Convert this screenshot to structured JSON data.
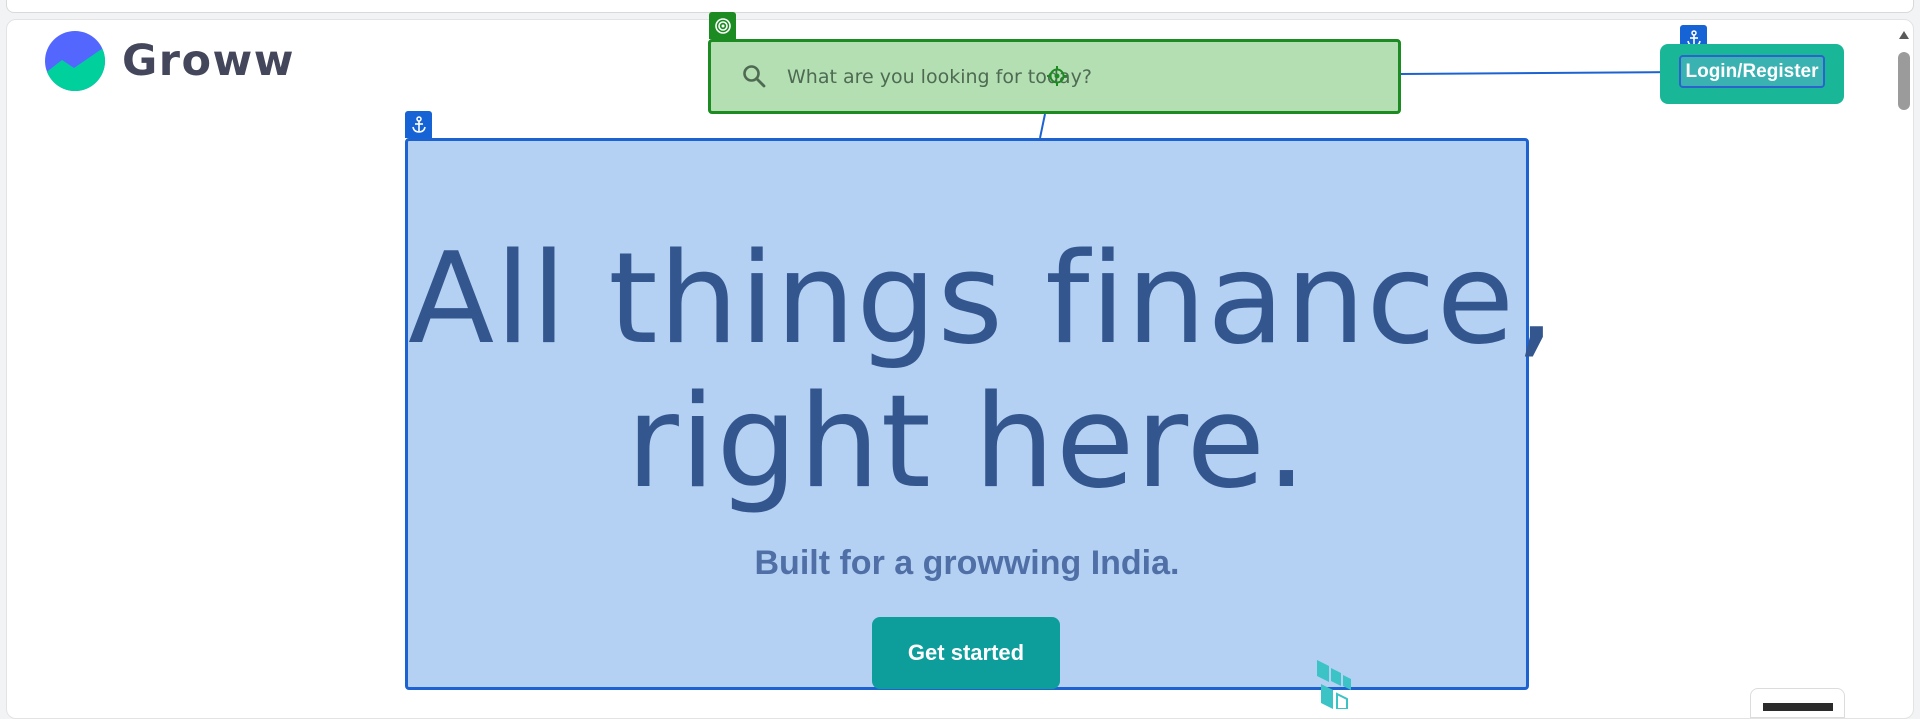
{
  "brand": {
    "name": "Groww"
  },
  "search": {
    "placeholder": "What are you looking for today?"
  },
  "header": {
    "login_label": "Login/Register"
  },
  "hero": {
    "headline_line1": "All things finance,",
    "headline_line2": "right here.",
    "subtitle": "Built for a growwing India.",
    "cta_label": "Get started"
  },
  "icons": {
    "search": "search-icon",
    "anchor": "anchor-icon",
    "target": "target-icon",
    "crosshair": "crosshair-icon"
  },
  "colors": {
    "brand_teal": "#00d09c",
    "brand_blue": "#5367ff",
    "login_bg": "#19b797",
    "cta_bg": "#0d9e9c",
    "hero_text": "#34568e",
    "overlay_blue": "#b4d1f3",
    "overlay_green": "#b3dfb3"
  }
}
